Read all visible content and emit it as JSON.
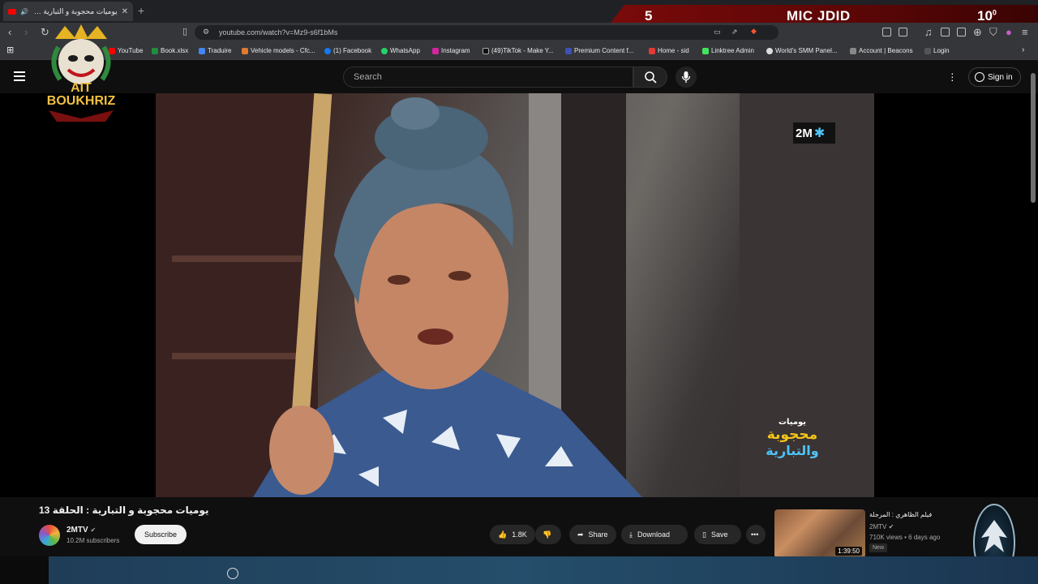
{
  "browser": {
    "tab_title": "يوميات محجوبة و التبارية : الحلقة 13",
    "url": "youtube.com/watch?v=Mz9-s6f1bMs",
    "bookmarks": [
      "YouTube",
      "Book.xlsx",
      "Traduire",
      "Vehicle models - Cfc...",
      "(1) Facebook",
      "WhatsApp",
      "Instagram",
      "(49)TikTok - Make Y...",
      "Premium Content f...",
      "Home - sid",
      "Linktree Admin",
      "World's SMM Panel...",
      "Account | Beacons",
      "Login"
    ]
  },
  "overlay": {
    "score": "5",
    "title": "MIC JDID",
    "time": "10",
    "time_sup": "0",
    "logo_line1": "AIT",
    "logo_line2": "BOUKHRIZ"
  },
  "header": {
    "search_placeholder": "Search",
    "signin_label": "Sign in"
  },
  "video": {
    "channel_bug": "2M",
    "show_logo_top": "يوميات",
    "show_logo_mid": "محجوبة",
    "show_logo_bottom": "والتبارية"
  },
  "info": {
    "title": "يوميات محجوبة و التبارية : الحلقة 13",
    "channel_name": "2MTV",
    "subscribers": "10.2M subscribers",
    "subscribe_label": "Subscribe",
    "like_count": "1.8K",
    "share_label": "Share",
    "download_label": "Download",
    "save_label": "Save"
  },
  "recommended": {
    "title": "فيلم الظاهري : المرجلة",
    "channel": "2MTV",
    "meta": "710K views • 6 days ago",
    "badge": "New",
    "duration": "1:39:50"
  },
  "colors": {
    "banner_red": "#7a0a0a",
    "yt_red": "#ff0000",
    "bg": "#0f0f0f"
  }
}
